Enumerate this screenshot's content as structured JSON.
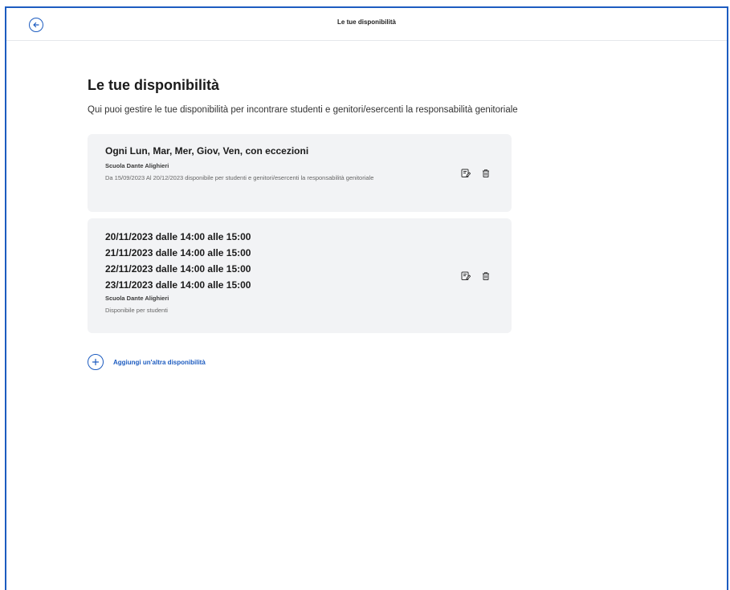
{
  "header": {
    "title": "Le tue disponibilità",
    "back_icon": "arrow-left-circle-icon"
  },
  "main": {
    "title": "Le tue disponibilità",
    "description": "Qui puoi gestire le tue disponibilità per incontrare studenti e genitori/esercenti la responsabilità genitoriale",
    "cards": [
      {
        "title": "Ogni Lun, Mar, Mer, Giov, Ven, con eccezioni",
        "school": "Scuola Dante Alighieri",
        "description": "Da 15/09/2023 Al 20/12/2023 disponibile per studenti e genitori/esercenti la responsabilità genitoriale",
        "actions": [
          "edit-icon",
          "trash-icon"
        ]
      },
      {
        "dates": [
          "20/11/2023 dalle 14:00 alle 15:00",
          "21/11/2023 dalle 14:00 alle 15:00",
          "22/11/2023 dalle 14:00 alle 15:00",
          "23/11/2023 dalle 14:00 alle 15:00"
        ],
        "school": "Scuola Dante Alighieri",
        "description": "Disponibile per studenti",
        "actions": [
          "edit-icon",
          "trash-icon"
        ]
      }
    ],
    "add_label": "Aggiungi un'altra disponibilità"
  },
  "colors": {
    "accent": "#1d5cc0",
    "card_bg": "#f2f3f5",
    "border": "#e5e7eb"
  }
}
